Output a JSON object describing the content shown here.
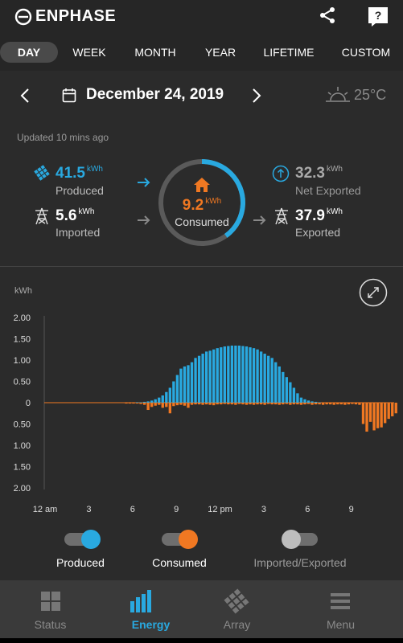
{
  "app": {
    "brand": "ENPHASE"
  },
  "tabs": [
    {
      "label": "DAY",
      "active": true
    },
    {
      "label": "WEEK"
    },
    {
      "label": "MONTH"
    },
    {
      "label": "YEAR"
    },
    {
      "label": "LIFETIME"
    },
    {
      "label": "CUSTOM"
    }
  ],
  "date": {
    "label": "December 24, 2019"
  },
  "weather": {
    "temp": "25°C"
  },
  "updated": "Updated 10 mins ago",
  "summary": {
    "produced": {
      "value": "41.5",
      "unit": "kWh",
      "label": "Produced"
    },
    "imported": {
      "value": "5.6",
      "unit": "kWh",
      "label": "Imported"
    },
    "consumed": {
      "value": "9.2",
      "unit": "kWh",
      "label": "Consumed",
      "ring_fraction": 0.4
    },
    "net_exported": {
      "value": "32.3",
      "unit": "kWh",
      "label": "Net Exported"
    },
    "exported": {
      "value": "37.9",
      "unit": "kWh",
      "label": "Exported"
    }
  },
  "chart_data": {
    "type": "bar",
    "ylabel": "kWh",
    "y_tick_labels": [
      "2.00",
      "1.50",
      "1.00",
      "0.50",
      "0",
      "0.50",
      "1.00",
      "1.50",
      "2.00"
    ],
    "ylim": [
      -2,
      2
    ],
    "x_tick_labels": [
      "12 am",
      "3",
      "6",
      "9",
      "12 pm",
      "3",
      "6",
      "9"
    ],
    "interval": "15 min",
    "grid": false,
    "series": [
      {
        "name": "Produced",
        "color": "#29a9e0",
        "values": [
          0.01,
          0.01,
          0.02,
          0.03,
          0.05,
          0.08,
          0.12,
          0.17,
          0.25,
          0.35,
          0.5,
          0.65,
          0.8,
          0.85,
          0.88,
          0.95,
          1.05,
          1.1,
          1.15,
          1.2,
          1.22,
          1.25,
          1.28,
          1.3,
          1.32,
          1.33,
          1.34,
          1.34,
          1.34,
          1.33,
          1.32,
          1.3,
          1.28,
          1.25,
          1.2,
          1.15,
          1.1,
          1.05,
          0.95,
          0.85,
          0.72,
          0.6,
          0.48,
          0.35,
          0.22,
          0.12,
          0.08,
          0.05,
          0.03,
          0.02,
          0.01
        ]
      },
      {
        "name": "Consumed",
        "color": "#f07822",
        "values": [
          -0.02,
          -0.02,
          -0.02,
          -0.02,
          -0.03,
          -0.05,
          -0.17,
          -0.1,
          -0.07,
          -0.05,
          -0.12,
          -0.1,
          -0.25,
          -0.08,
          -0.06,
          -0.05,
          -0.07,
          -0.12,
          -0.05,
          -0.04,
          -0.04,
          -0.05,
          -0.04,
          -0.05,
          -0.06,
          -0.04,
          -0.04,
          -0.03,
          -0.04,
          -0.04,
          -0.05,
          -0.03,
          -0.04,
          -0.05,
          -0.04,
          -0.05,
          -0.04,
          -0.04,
          -0.05,
          -0.03,
          -0.04,
          -0.04,
          -0.05,
          -0.04,
          -0.03,
          -0.05,
          -0.04,
          -0.04,
          -0.05,
          -0.04,
          -0.03,
          -0.05,
          -0.04,
          -0.04,
          -0.05,
          -0.04,
          -0.04,
          -0.05,
          -0.04,
          -0.04,
          -0.05,
          -0.04,
          -0.03,
          -0.04,
          -0.05,
          -0.5,
          -0.68,
          -0.45,
          -0.65,
          -0.6,
          -0.58,
          -0.48,
          -0.38,
          -0.32,
          -0.25
        ]
      }
    ]
  },
  "legend": [
    {
      "label": "Produced",
      "color": "#29a9e0",
      "on": true
    },
    {
      "label": "Consumed",
      "color": "#f07822",
      "on": true
    },
    {
      "label": "Imported/Exported",
      "color": "#bdbdbd",
      "on": false
    }
  ],
  "nav": [
    {
      "label": "Status",
      "icon": "grid-icon"
    },
    {
      "label": "Energy",
      "icon": "bar-chart-icon",
      "active": true
    },
    {
      "label": "Array",
      "icon": "solar-panel-icon"
    },
    {
      "label": "Menu",
      "icon": "hamburger-menu-icon"
    }
  ]
}
